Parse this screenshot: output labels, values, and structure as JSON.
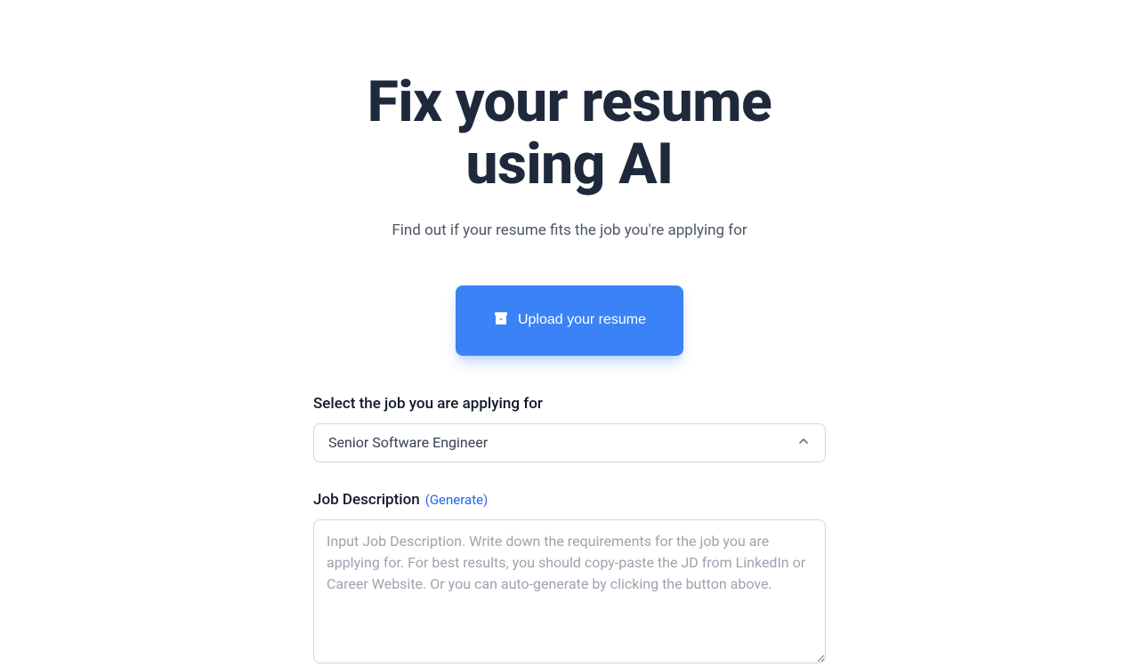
{
  "hero": {
    "title": "Fix your resume using AI",
    "subtitle": "Find out if your resume fits the job you're applying for"
  },
  "upload": {
    "label": "Upload your resume"
  },
  "job_select": {
    "label": "Select the job you are applying for",
    "value": "Senior Software Engineer"
  },
  "job_description": {
    "label": "Job Description",
    "generate_label": "(Generate)",
    "placeholder": "Input Job Description. Write down the requirements for the job you are applying for. For best results, you should copy-paste the JD from LinkedIn or Career Website. Or you can auto-generate by clicking the button above."
  }
}
